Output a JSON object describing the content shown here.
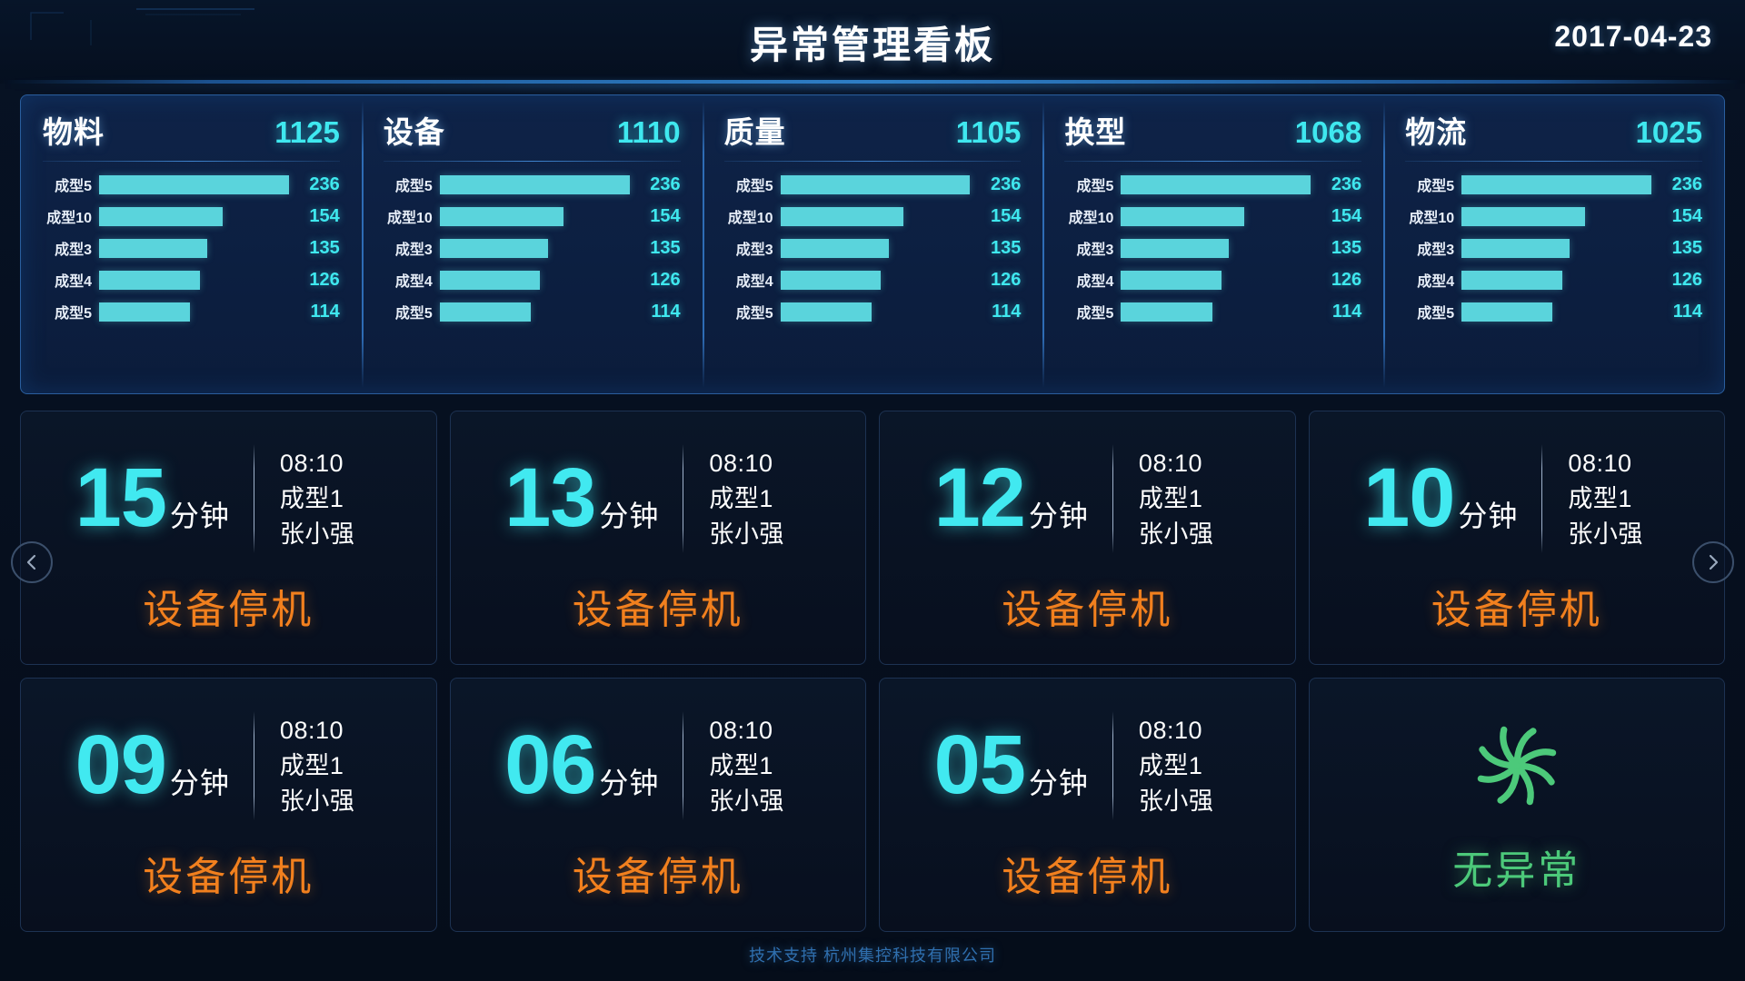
{
  "header": {
    "title": "异常管理看板",
    "date": "2017-04-23"
  },
  "kpi": {
    "cards": [
      {
        "name": "物料",
        "total": "1125",
        "bars": [
          {
            "label": "成型5",
            "value": "236"
          },
          {
            "label": "成型10",
            "value": "154"
          },
          {
            "label": "成型3",
            "value": "135"
          },
          {
            "label": "成型4",
            "value": "126"
          },
          {
            "label": "成型5",
            "value": "114"
          }
        ]
      },
      {
        "name": "设备",
        "total": "1110",
        "bars": [
          {
            "label": "成型5",
            "value": "236"
          },
          {
            "label": "成型10",
            "value": "154"
          },
          {
            "label": "成型3",
            "value": "135"
          },
          {
            "label": "成型4",
            "value": "126"
          },
          {
            "label": "成型5",
            "value": "114"
          }
        ]
      },
      {
        "name": "质量",
        "total": "1105",
        "bars": [
          {
            "label": "成型5",
            "value": "236"
          },
          {
            "label": "成型10",
            "value": "154"
          },
          {
            "label": "成型3",
            "value": "135"
          },
          {
            "label": "成型4",
            "value": "126"
          },
          {
            "label": "成型5",
            "value": "114"
          }
        ]
      },
      {
        "name": "换型",
        "total": "1068",
        "bars": [
          {
            "label": "成型5",
            "value": "236"
          },
          {
            "label": "成型10",
            "value": "154"
          },
          {
            "label": "成型3",
            "value": "135"
          },
          {
            "label": "成型4",
            "value": "126"
          },
          {
            "label": "成型5",
            "value": "114"
          }
        ]
      },
      {
        "name": "物流",
        "total": "1025",
        "bars": [
          {
            "label": "成型5",
            "value": "236"
          },
          {
            "label": "成型10",
            "value": "154"
          },
          {
            "label": "成型3",
            "value": "135"
          },
          {
            "label": "成型4",
            "value": "126"
          },
          {
            "label": "成型5",
            "value": "114"
          }
        ]
      }
    ],
    "bar_max": 236
  },
  "alerts": {
    "unit": "分钟",
    "cards": [
      {
        "minutes": "15",
        "time": "08:10",
        "line": "成型1",
        "person": "张小强",
        "type": "设备停机"
      },
      {
        "minutes": "13",
        "time": "08:10",
        "line": "成型1",
        "person": "张小强",
        "type": "设备停机"
      },
      {
        "minutes": "12",
        "time": "08:10",
        "line": "成型1",
        "person": "张小强",
        "type": "设备停机"
      },
      {
        "minutes": "10",
        "time": "08:10",
        "line": "成型1",
        "person": "张小强",
        "type": "设备停机"
      },
      {
        "minutes": "09",
        "time": "08:10",
        "line": "成型1",
        "person": "张小强",
        "type": "设备停机"
      },
      {
        "minutes": "06",
        "time": "08:10",
        "line": "成型1",
        "person": "张小强",
        "type": "设备停机"
      },
      {
        "minutes": "05",
        "time": "08:10",
        "line": "成型1",
        "person": "张小强",
        "type": "设备停机"
      }
    ],
    "normal_label": "无异常"
  },
  "nav": {
    "prev": "‹",
    "next": "›"
  },
  "footer": {
    "text": "技术支持 杭州集控科技有限公司"
  },
  "colors": {
    "accent_cyan": "#3fe8ef",
    "bar_cyan": "#5ad4dc",
    "alert_orange": "#f2801e",
    "normal_green": "#4cc97a",
    "panel_bg": "#0e2348",
    "panel_border": "#2a5e9e",
    "page_bg": "#050d1a"
  }
}
